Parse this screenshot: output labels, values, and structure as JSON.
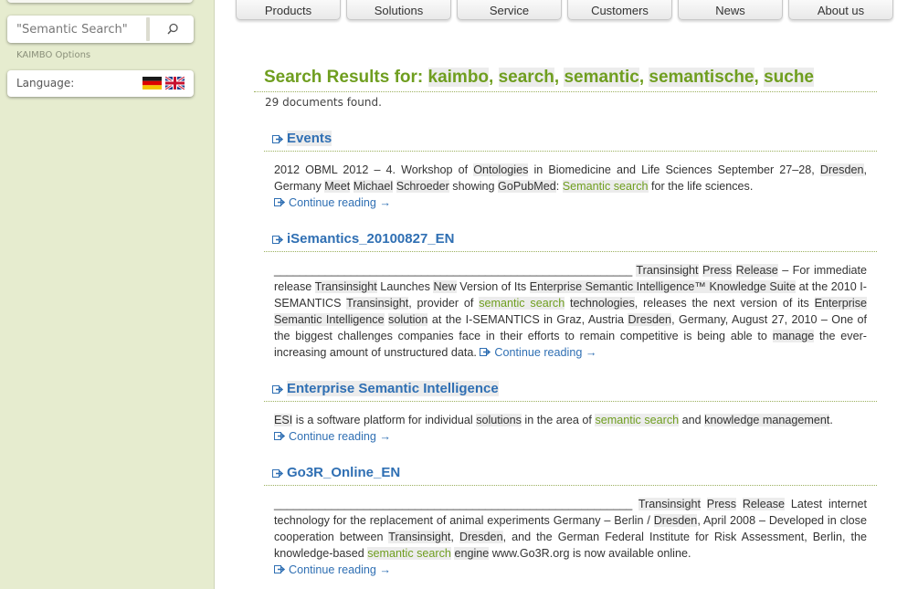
{
  "sidebar": {
    "search": {
      "value": "\"Semantic Search\"",
      "button_icon": "search-icon"
    },
    "options_label": "KAIMBO Options",
    "language": {
      "label": "Language:",
      "flags": [
        "german-flag-icon",
        "english-flag-icon"
      ]
    }
  },
  "nav": {
    "tabs": [
      "Products",
      "Solutions",
      "Service",
      "Customers",
      "News",
      "About us"
    ]
  },
  "search_results": {
    "title_prefix": "Search Results for:",
    "terms": [
      "kaimbo",
      "search",
      "semantic",
      "semantische",
      "suche"
    ],
    "count_text": "29 documents found."
  },
  "results": [
    {
      "title": "Events",
      "continue": "Continue reading →"
    },
    {
      "title": "iSemantics_20100827_EN",
      "continue": "Continue reading →"
    },
    {
      "title": "Enterprise Semantic Intelligence",
      "continue": "Continue reading →"
    },
    {
      "title": "Go3R_Online_EN",
      "continue": "Continue reading →"
    }
  ],
  "snippets": {
    "r1": [
      "2012 OBML 2012 – 4. Workshop of ",
      "Ontologies",
      " in Biomedicine and Life Sciences September 27–28, ",
      "Dresden",
      ", Germany    ",
      "Meet",
      " ",
      "Michael",
      " ",
      "Schroeder",
      " showing ",
      "GoPubMed",
      ": ",
      "Semantic search",
      " for the life sciences."
    ],
    "r2": [
      "________________________________________________________ ",
      "Transinsight",
      " ",
      "Press",
      " ",
      "Release",
      " – For immediate release ",
      "Transinsight",
      " Launches ",
      "New",
      " Version of Its ",
      "Enterprise Semantic Intelligence™ Knowledge Suite",
      " at the 2010 I-SEMANTICS ",
      "Transinsight",
      ", provider of ",
      "semantic search",
      " ",
      "technologies",
      ", releases the next version of its ",
      "Enterprise Semantic Intelligence",
      " ",
      "solution",
      " at the I-SEMANTICS in Graz, Austria ",
      "Dresden",
      ", Germany, August 27, 2010 – One of the biggest challenges companies face in their efforts to remain competitive is being able to ",
      "manage",
      " the ever-increasing amount of unstructured data. "
    ],
    "r3": [
      "ESI",
      " is a software platform for individual ",
      "solutions",
      " in the area of ",
      "semantic search",
      " and ",
      "knowledge management",
      "."
    ],
    "r4": [
      "________________________________________________________ ",
      "Transinsight",
      " ",
      "Press",
      " ",
      "Release",
      " Latest internet technology for the replacement of animal experiments Germany – Berlin / ",
      "Dresden",
      ", April 2008 – Developed in close cooperation between ",
      "Transinsight",
      ", ",
      "Dresden",
      ", and the German Federal Institute for Risk Assessment, Berlin, the knowledge-based ",
      "semantic search",
      " ",
      "engine",
      " www.Go3R.org is now available online."
    ]
  },
  "colors": {
    "accent_green": "#6f9e1f",
    "link_blue": "#2f6fb3",
    "background": "#e6eccf"
  }
}
